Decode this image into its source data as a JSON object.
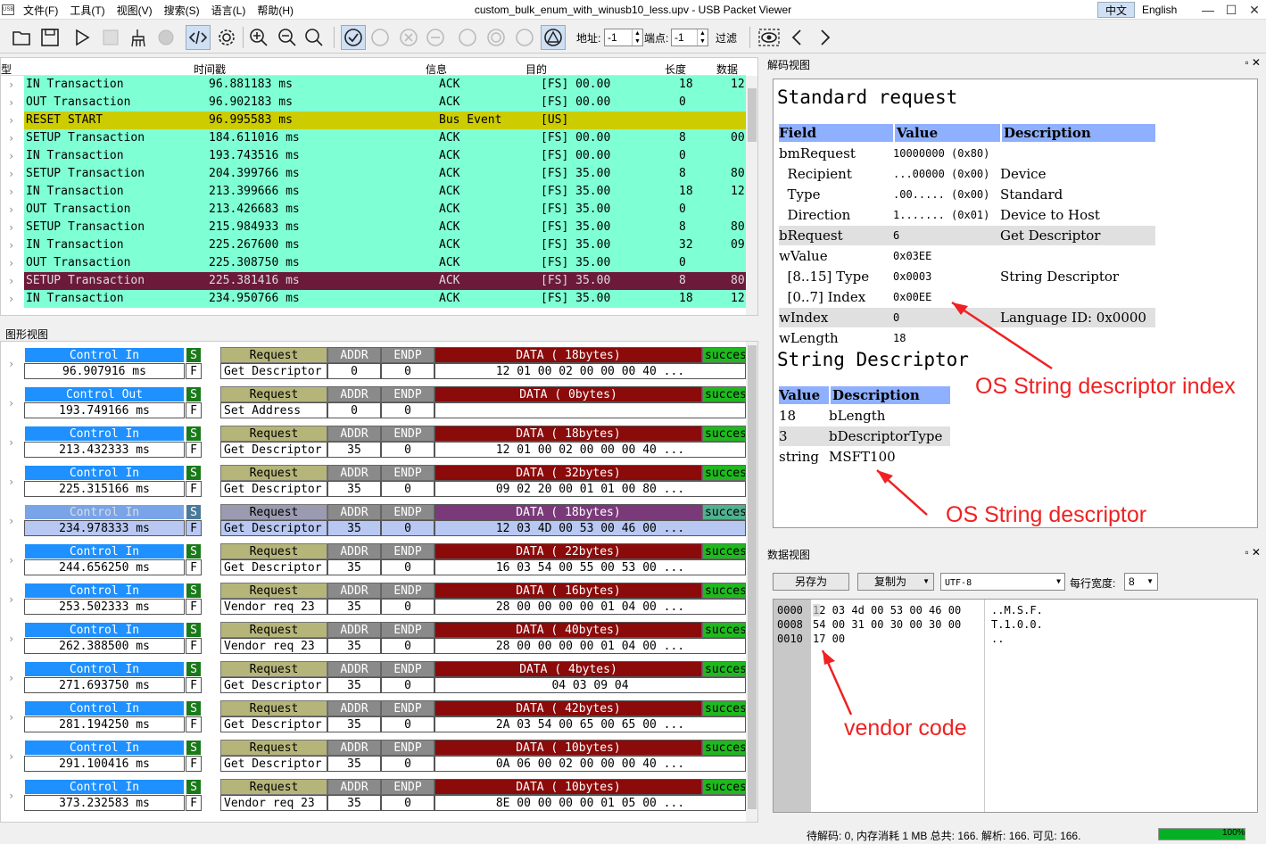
{
  "app": {
    "logo": "USB",
    "title": "custom_bulk_enum_with_winusb10_less.upv - USB Packet Viewer",
    "lang_zh": "中文",
    "lang_en": "English"
  },
  "menu": [
    "文件(F)",
    "工具(T)",
    "视图(V)",
    "搜索(S)",
    "语言(L)",
    "帮助(H)"
  ],
  "toolbar": {
    "addr_label": "地址:",
    "addr_value": "-1",
    "endp_label": "端点:",
    "endp_value": "-1",
    "filter_label": "过滤"
  },
  "packet_list": {
    "headers": [
      "型",
      "时间戳",
      "信息",
      "目的",
      "长度",
      "数据"
    ],
    "rows": [
      {
        "type": "IN Transaction",
        "time": "96.881183 ms",
        "info": "ACK",
        "dest": "[FS] 00.00",
        "len": "18",
        "data": "12",
        "color": "#7fffd4"
      },
      {
        "type": "OUT Transaction",
        "time": "96.902183 ms",
        "info": "ACK",
        "dest": "[FS] 00.00",
        "len": "0",
        "data": "",
        "color": "#7fffd4"
      },
      {
        "type": "RESET START",
        "time": "96.995583 ms",
        "info": "Bus Event",
        "dest": "[US]",
        "len": "",
        "data": "",
        "color": "#cccc00"
      },
      {
        "type": "SETUP Transaction",
        "time": "184.611016 ms",
        "info": "ACK",
        "dest": "[FS] 00.00",
        "len": "8",
        "data": "00",
        "color": "#7fffd4"
      },
      {
        "type": "IN Transaction",
        "time": "193.743516 ms",
        "info": "ACK",
        "dest": "[FS] 00.00",
        "len": "0",
        "data": "",
        "color": "#7fffd4"
      },
      {
        "type": "SETUP Transaction",
        "time": "204.399766 ms",
        "info": "ACK",
        "dest": "[FS] 35.00",
        "len": "8",
        "data": "80",
        "color": "#7fffd4"
      },
      {
        "type": "IN Transaction",
        "time": "213.399666 ms",
        "info": "ACK",
        "dest": "[FS] 35.00",
        "len": "18",
        "data": "12",
        "color": "#7fffd4"
      },
      {
        "type": "OUT Transaction",
        "time": "213.426683 ms",
        "info": "ACK",
        "dest": "[FS] 35.00",
        "len": "0",
        "data": "",
        "color": "#7fffd4"
      },
      {
        "type": "SETUP Transaction",
        "time": "215.984933 ms",
        "info": "ACK",
        "dest": "[FS] 35.00",
        "len": "8",
        "data": "80",
        "color": "#7fffd4"
      },
      {
        "type": "IN Transaction",
        "time": "225.267600 ms",
        "info": "ACK",
        "dest": "[FS] 35.00",
        "len": "32",
        "data": "09",
        "color": "#7fffd4"
      },
      {
        "type": "OUT Transaction",
        "time": "225.308750 ms",
        "info": "ACK",
        "dest": "[FS] 35.00",
        "len": "0",
        "data": "",
        "color": "#7fffd4"
      },
      {
        "type": "SETUP Transaction",
        "time": "225.381416 ms",
        "info": "ACK",
        "dest": "[FS] 35.00",
        "len": "8",
        "data": "80",
        "color": "#6b1a3a"
      },
      {
        "type": "IN Transaction",
        "time": "234.950766 ms",
        "info": "ACK",
        "dest": "[FS] 35.00",
        "len": "18",
        "data": "12",
        "color": "#7fffd4"
      }
    ]
  },
  "graph_view": {
    "title": "图形视图",
    "hdr_request": "Request",
    "hdr_addr": "ADDR",
    "hdr_endp": "ENDP",
    "flag_s": "S",
    "flag_f": "F",
    "success": "success",
    "rows": [
      {
        "ctl": "Control In",
        "time": "96.907916 ms",
        "req": "Get Descriptor",
        "addr": "0",
        "endp": "0",
        "data_hdr": "DATA ( 18bytes)",
        "data": "12 01 00 02 00 00 00 40 ..."
      },
      {
        "ctl": "Control Out",
        "time": "193.749166 ms",
        "req": "Set Address",
        "addr": "0",
        "endp": "0",
        "data_hdr": "DATA ( 0bytes)",
        "data": ""
      },
      {
        "ctl": "Control In",
        "time": "213.432333 ms",
        "req": "Get Descriptor",
        "addr": "35",
        "endp": "0",
        "data_hdr": "DATA ( 18bytes)",
        "data": "12 01 00 02 00 00 00 40 ..."
      },
      {
        "ctl": "Control In",
        "time": "225.315166 ms",
        "req": "Get Descriptor",
        "addr": "35",
        "endp": "0",
        "data_hdr": "DATA ( 32bytes)",
        "data": "09 02 20 00 01 01 00 80 ..."
      },
      {
        "ctl": "Control In",
        "time": "234.978333 ms",
        "req": "Get Descriptor",
        "addr": "35",
        "endp": "0",
        "data_hdr": "DATA ( 18bytes)",
        "data": "12 03 4D 00 53 00 46 00 ...",
        "selected": true
      },
      {
        "ctl": "Control In",
        "time": "244.656250 ms",
        "req": "Get Descriptor",
        "addr": "35",
        "endp": "0",
        "data_hdr": "DATA ( 22bytes)",
        "data": "16 03 54 00 55 00 53 00 ..."
      },
      {
        "ctl": "Control In",
        "time": "253.502333 ms",
        "req": "Vendor req 23",
        "addr": "35",
        "endp": "0",
        "data_hdr": "DATA ( 16bytes)",
        "data": "28 00 00 00 00 01 04 00 ..."
      },
      {
        "ctl": "Control In",
        "time": "262.388500 ms",
        "req": "Vendor req 23",
        "addr": "35",
        "endp": "0",
        "data_hdr": "DATA ( 40bytes)",
        "data": "28 00 00 00 00 01 04 00 ..."
      },
      {
        "ctl": "Control In",
        "time": "271.693750 ms",
        "req": "Get Descriptor",
        "addr": "35",
        "endp": "0",
        "data_hdr": "DATA ( 4bytes)",
        "data": "04 03 09 04"
      },
      {
        "ctl": "Control In",
        "time": "281.194250 ms",
        "req": "Get Descriptor",
        "addr": "35",
        "endp": "0",
        "data_hdr": "DATA ( 42bytes)",
        "data": "2A 03 54 00 65 00 65 00 ..."
      },
      {
        "ctl": "Control In",
        "time": "291.100416 ms",
        "req": "Get Descriptor",
        "addr": "35",
        "endp": "0",
        "data_hdr": "DATA ( 10bytes)",
        "data": "0A 06 00 02 00 00 00 40 ..."
      },
      {
        "ctl": "Control In",
        "time": "373.232583 ms",
        "req": "Vendor req 23",
        "addr": "35",
        "endp": "0",
        "data_hdr": "DATA ( 10bytes)",
        "data": "8E 00 00 00 00 01 05 00 ..."
      }
    ]
  },
  "decode_view": {
    "title": "解码视图",
    "heading1": "Standard request",
    "th": [
      "Field",
      "Value",
      "Description"
    ],
    "rows": [
      {
        "f": "bmRequest",
        "v": "10000000 (0x80)",
        "d": "",
        "shade": false
      },
      {
        "f": "  Recipient",
        "v": "...00000 (0x00)",
        "d": "Device",
        "shade": false
      },
      {
        "f": "  Type",
        "v": ".00..... (0x00)",
        "d": "Standard",
        "shade": false
      },
      {
        "f": "  Direction",
        "v": "1....... (0x01)",
        "d": "Device to Host",
        "shade": false
      },
      {
        "f": "bRequest",
        "v": "6",
        "d": "Get Descriptor",
        "shade": true
      },
      {
        "f": "wValue",
        "v": "0x03EE",
        "d": "",
        "shade": false
      },
      {
        "f": "  [8..15] Type",
        "v": "0x0003",
        "d": "String Descriptor",
        "shade": false
      },
      {
        "f": "  [0..7] Index",
        "v": "0x00EE",
        "d": "",
        "shade": false
      },
      {
        "f": "wIndex",
        "v": "0",
        "d": "Language ID: 0x0000",
        "shade": true
      },
      {
        "f": "wLength",
        "v": "18",
        "d": "",
        "shade": false
      }
    ],
    "heading2": "String Descriptor",
    "th2": [
      "Value",
      "Description"
    ],
    "rows2": [
      {
        "v": "18",
        "d": "bLength",
        "shade": false
      },
      {
        "v": "3",
        "d": "bDescriptorType",
        "shade": true
      },
      {
        "v": "string",
        "d": "MSFT100",
        "shade": false
      }
    ],
    "annot1": "OS String descriptor index",
    "annot2": "OS String descriptor"
  },
  "data_view": {
    "title": "数据视图",
    "save": "另存为",
    "copy": "复制为",
    "encoding": "UTF-8",
    "width_label": "每行宽度:",
    "width_value": "8",
    "offsets": [
      "0000",
      "0008",
      "0010"
    ],
    "hex": [
      "12 03 4d 00 53 00 46 00",
      "54 00 31 00 30 00 30 00",
      "17 00"
    ],
    "ascii": [
      "..M.S.F.",
      "T.1.0.0.",
      ".."
    ],
    "annot": "vendor code"
  },
  "status": {
    "text": "待解码: 0, 内存消耗 1 MB 总共: 166. 解析: 166. 可见: 166.",
    "progress": "100%"
  }
}
